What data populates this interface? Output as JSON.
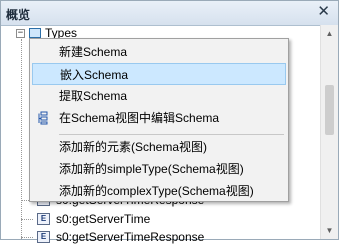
{
  "panel": {
    "title": "概览",
    "close_label": "✕"
  },
  "tree": {
    "root_label": "Types",
    "expander": "−",
    "items": [
      {
        "icon_letter": "E",
        "label": "s0:getServerTimeResponse"
      },
      {
        "icon_letter": "E",
        "label": "s0:getServerTime"
      },
      {
        "icon_letter": "E",
        "label": "s0:getServerTimeResponse"
      }
    ]
  },
  "context_menu": {
    "items": [
      {
        "label": "新建Schema"
      },
      {
        "label": "嵌入Schema",
        "selected": true
      },
      {
        "label": "提取Schema"
      },
      {
        "label": "在Schema视图中编辑Schema",
        "icon": "schema-edit-icon"
      },
      {
        "label": "添加新的元素(Schema视图)"
      },
      {
        "label": "添加新的simpleType(Schema视图)"
      },
      {
        "label": "添加新的complexType(Schema视图)"
      }
    ]
  }
}
